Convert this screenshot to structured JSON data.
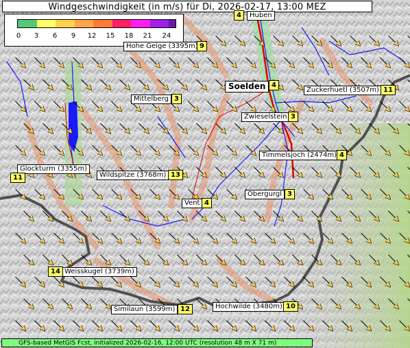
{
  "title": "Windgeschwindigkeit (in m/s) für Di, 2026-02-17, 13:00 MEZ",
  "legend": {
    "ticks": [
      "0",
      "3",
      "6",
      "9",
      "12",
      "15",
      "18",
      "21",
      "24"
    ],
    "colors": [
      "#55c878",
      "#ffff66",
      "#ffd24a",
      "#ffa64a",
      "#ff7a3a",
      "#ff1e64",
      "#ff1ef0",
      "#a01ee6",
      "#6a1aa6"
    ]
  },
  "places": [
    {
      "name": "Huben",
      "value": "4",
      "style": "small"
    },
    {
      "name": "Hohe Geige (3395m)",
      "value": "9",
      "style": "small"
    },
    {
      "name": "Soelden",
      "value": "4",
      "style": "big"
    },
    {
      "name": "Zuckerhuetl (3507m)",
      "value": "11",
      "style": "small"
    },
    {
      "name": "Mittelberg",
      "value": "3",
      "style": "small"
    },
    {
      "name": "Zwieselstein",
      "value": "3",
      "style": "small"
    },
    {
      "name": "Timmelsjoch (2474m)",
      "value": "4",
      "style": "small"
    },
    {
      "name": "Glockturm (3355m)",
      "value": "11",
      "style": "small"
    },
    {
      "name": "Wildspitze (3768m)",
      "value": "13",
      "style": "small"
    },
    {
      "name": "Obergurgl",
      "value": "3",
      "style": "small"
    },
    {
      "name": "Vent",
      "value": "4",
      "style": "small"
    },
    {
      "name": "Weisskugel (3739m)",
      "value": "14",
      "style": "small"
    },
    {
      "name": "Similaun (3599m)",
      "value": "12",
      "style": "small"
    },
    {
      "name": "Hochwilde (3480m)",
      "value": "10",
      "style": "small"
    }
  ],
  "footer": "GFS-based MetGIS Fcst, initialized 2026-02-16, 12:00 UTC  (resolution 48 m X 71 m)",
  "colors": {
    "terrain_light": "#e2e2e2",
    "terrain_dark": "#9a9a9a",
    "ridge": "#e8916a",
    "river": "#1a1aff",
    "road": "#e00000",
    "border": "#505050",
    "lowland": "#b8d88a",
    "arrow": "#ffe066"
  },
  "arrow_direction": "from northwest (toward southeast)"
}
